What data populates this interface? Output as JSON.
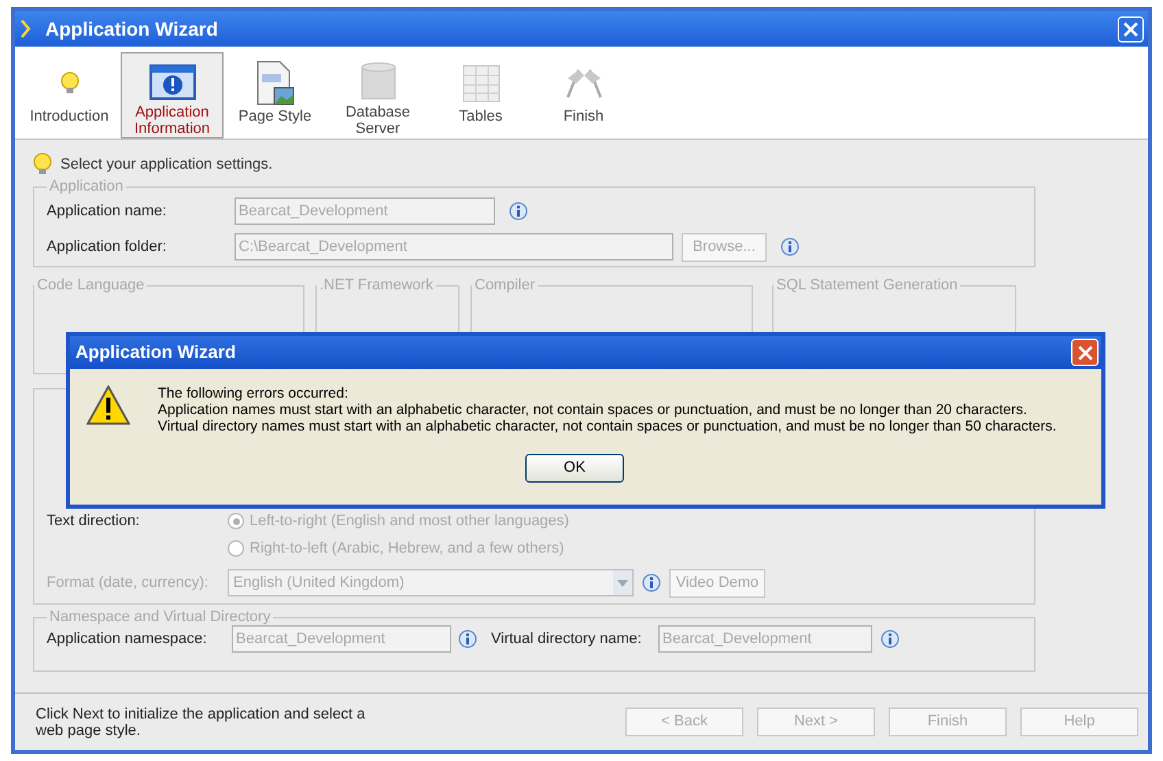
{
  "window": {
    "title": "Application Wizard"
  },
  "steps": [
    {
      "label": "Introduction",
      "selected": false
    },
    {
      "label": "Application Information",
      "selected": true
    },
    {
      "label": "Page Style",
      "selected": false
    },
    {
      "label": "Database Server",
      "selected": false
    },
    {
      "label": "Tables",
      "selected": false
    },
    {
      "label": "Finish",
      "selected": false
    }
  ],
  "hint": "Select your application settings.",
  "application": {
    "legend": "Application",
    "name_label": "Application name:",
    "name_value": "Bearcat_Development",
    "folder_label": "Application folder:",
    "folder_value": "C:\\Bearcat_Development",
    "browse": "Browse..."
  },
  "groups": [
    {
      "legend": "Code Language"
    },
    {
      "legend": ".NET Framework"
    },
    {
      "legend": "Compiler"
    },
    {
      "legend": "SQL Statement Generation"
    }
  ],
  "language": {
    "text_direction_label": "Text direction:",
    "options": [
      {
        "label": "Left-to-right (English and most other languages)",
        "selected": true
      },
      {
        "label": "Right-to-left (Arabic, Hebrew, and a few others)",
        "selected": false
      }
    ],
    "format_label": "Format (date, currency):",
    "format_value": "English (United Kingdom)",
    "video_button": "Video Demo"
  },
  "namespace": {
    "legend": "Namespace and Virtual Directory",
    "namespace_label": "Application namespace:",
    "namespace_value": "Bearcat_Development",
    "vdir_label": "Virtual directory name:",
    "vdir_value": "Bearcat_Development"
  },
  "footer": {
    "text": "Click Next to initialize the application and select a web page style.",
    "buttons": [
      "< Back",
      "Next >",
      "Finish",
      "Help"
    ]
  },
  "dialog": {
    "title": "Application Wizard",
    "heading": "The following errors occurred:",
    "errors": [
      "Application names must start with an alphabetic character, not contain spaces or punctuation, and must be no longer than 20 characters.",
      "Virtual directory names must start with an alphabetic character, not contain spaces or punctuation, and must be no longer than 50 characters."
    ],
    "button": "OK"
  }
}
